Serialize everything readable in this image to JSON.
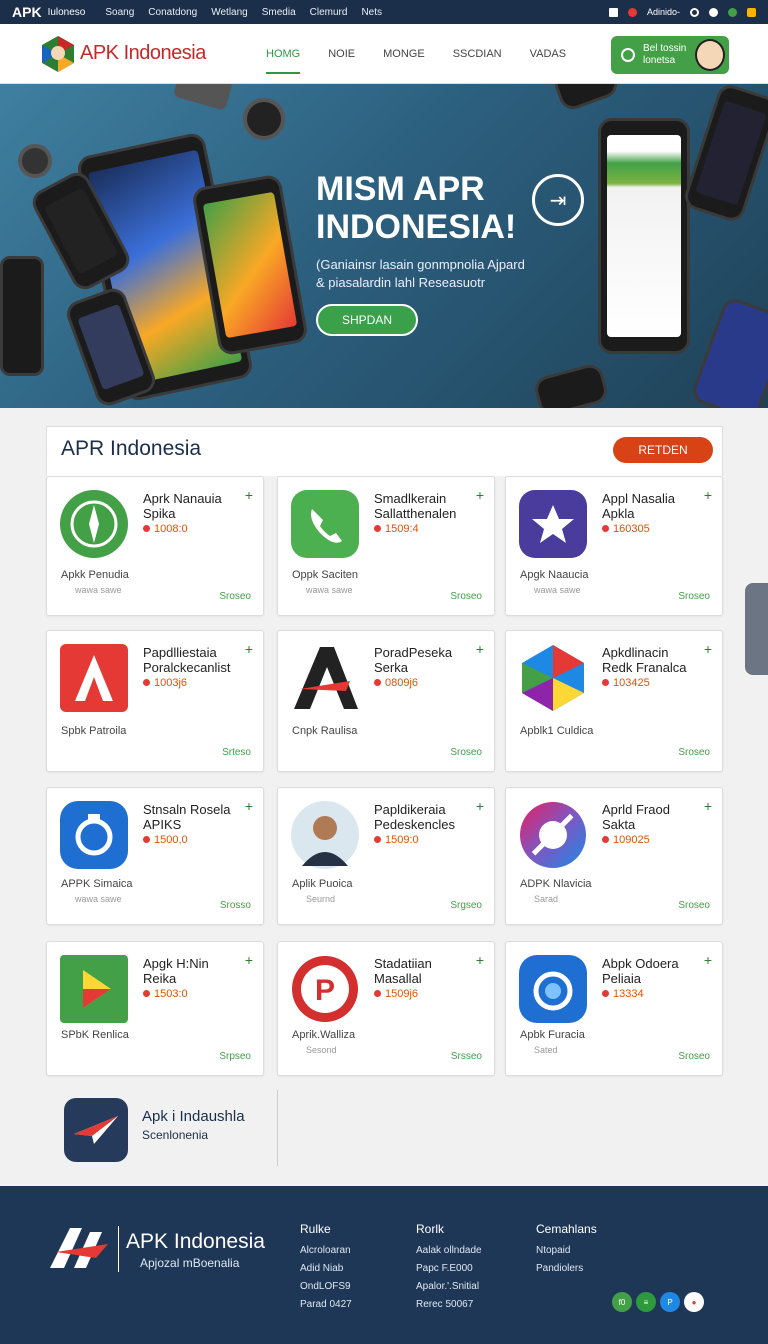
{
  "topbar": {
    "brand": "APK",
    "brand_sub": "Iuloneso",
    "links": [
      "Soang",
      "Conatdong",
      "Wetlang",
      "Smedia",
      "Clemurd",
      "Nets"
    ],
    "right_text": "Adinido-"
  },
  "header": {
    "logo_text": "APK Indonesia",
    "nav": [
      "HOMG",
      "NOIE",
      "MONGE",
      "SSCDIAN",
      "VADAS"
    ],
    "cta_line1": "Bel tossin",
    "cta_line2": "lonetsa"
  },
  "hero": {
    "title_line1": "MISM APR",
    "title_line2": "INDONESIA!",
    "subtitle_line1": "(Ganiainsr lasain gonmpnolia Ajpard",
    "subtitle_line2": "& piasalardin lahl Reseasuotr",
    "button": "SHPDAN",
    "arrow": "⇥"
  },
  "panel": {
    "title": "APR Indonesia",
    "button": "RETDEN"
  },
  "cards": [
    {
      "name1": "Aprk Nanauia",
      "name2": "Spika",
      "rating": "1008:0",
      "sub1": "Apkk Penudia",
      "sub2": "wawa sawe",
      "action": "Sroseo",
      "icon": "compass-green"
    },
    {
      "name1": "Smadlkerain",
      "name2": "Sallatthenalen",
      "rating": "1509:4",
      "sub1": "Oppk Saciten",
      "sub2": "wawa sawe",
      "action": "Sroseo",
      "icon": "phone-green"
    },
    {
      "name1": "Appl Nasalia",
      "name2": "Apkla",
      "rating": "160305",
      "sub1": "Apgk Naaucia",
      "sub2": "wawa sawe",
      "action": "Sroseo",
      "icon": "star-purple"
    },
    {
      "name1": "Papdlliestaia",
      "name2": "Poralckecanlist",
      "rating": "1003j6",
      "sub1": "Spbk Patroila",
      "sub2": "",
      "action": "Srteso",
      "icon": "a-red"
    },
    {
      "name1": "PoradPeseka",
      "name2": "Serka",
      "rating": "0809j6",
      "sub1": "Cnpk Raulisa",
      "sub2": "",
      "action": "Sroseo",
      "icon": "a-black"
    },
    {
      "name1": "Apkdlinacin",
      "name2": "Redk Franalca",
      "rating": "103425",
      "sub1": "Apblk1 Culdica",
      "sub2": "",
      "action": "Sroseo",
      "icon": "poly-multi"
    },
    {
      "name1": "Stnsaln Rosela",
      "name2": "APIKS",
      "rating": "1500,0",
      "sub1": "APPK Simaica",
      "sub2": "wawa sawe",
      "action": "Srosso",
      "icon": "ring-blue"
    },
    {
      "name1": "Papldikeraia",
      "name2": "Pedeskencles",
      "rating": "1509:0",
      "sub1": "Aplik Puoica",
      "sub2": "Seurnd",
      "action": "Srgseo",
      "icon": "portrait"
    },
    {
      "name1": "Aprld Fraod",
      "name2": "Sakta",
      "rating": "109025",
      "sub1": "ADPK Nlavicia",
      "sub2": "Sarad",
      "action": "Sroseo",
      "icon": "circle-grad"
    },
    {
      "name1": "Apgk H:Nin",
      "name2": "Reika",
      "rating": "1503:0",
      "sub1": "SPbK Renlica",
      "sub2": "",
      "action": "Srpseo",
      "icon": "play-green"
    },
    {
      "name1": "Stadatiian",
      "name2": "Masallal",
      "rating": "1509j6",
      "sub1": "Aprik.Walliza",
      "sub2": "Sesond",
      "action": "Srsseo",
      "icon": "p-red"
    },
    {
      "name1": "Abpk Odoera",
      "name2": "Peliaia",
      "rating": "13334",
      "sub1": "Apbk Furacia",
      "sub2": "Sated",
      "action": "Sroseo",
      "icon": "ring-blue2"
    }
  ],
  "extra": {
    "line1": "Apk i Indaushla",
    "line2": "Scenlonenia"
  },
  "footer": {
    "name": "APK Indonesia",
    "tagline": "Apjozal mBoenalia",
    "col1": {
      "head": "Rulke",
      "items": [
        "Alcroloaran",
        "Adid Niab",
        "OndLOFS9",
        "Parad 0427"
      ]
    },
    "col2": {
      "head": "Rorlk",
      "items": [
        "Aalak ollndade",
        "Papc F.E000",
        "Apalor.'.Snitial",
        "Rerec 50067"
      ]
    },
    "col3": {
      "head": "Cemahlans",
      "items": [
        "Ntopaid",
        "Pandiolers"
      ]
    },
    "social": [
      "f0",
      "≡",
      "P",
      "●"
    ]
  },
  "colors": {
    "topbar": "#1c2f4a",
    "accent_green": "#43a047",
    "accent_red": "#d84315",
    "footer": "#1f3756"
  }
}
